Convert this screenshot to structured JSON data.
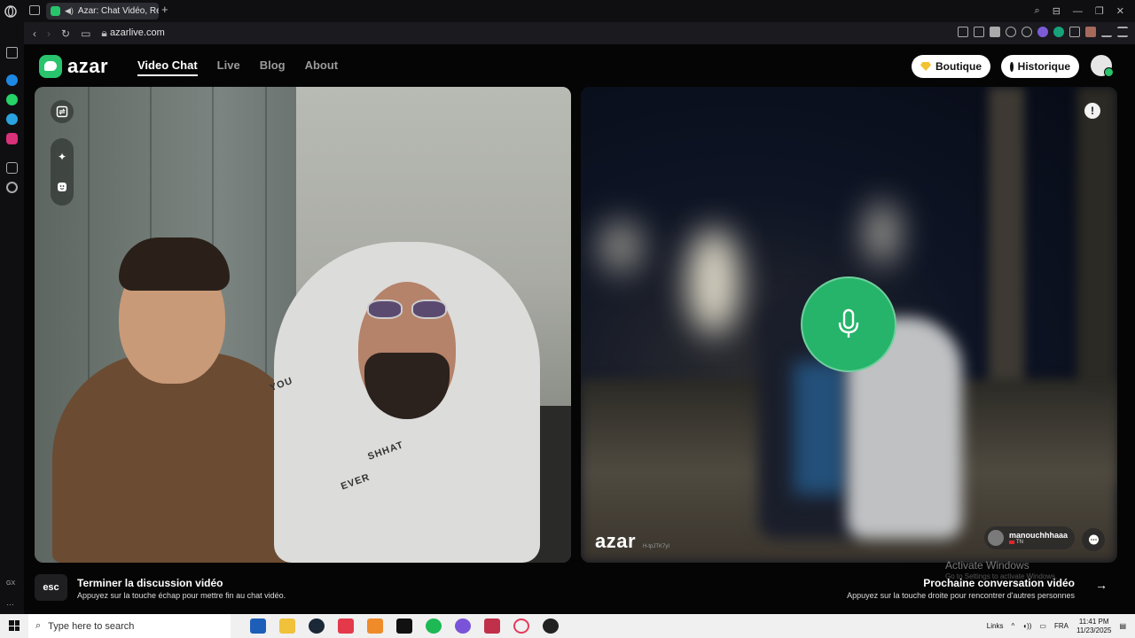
{
  "browser": {
    "tab_title": "Azar: Chat Vidéo, Ren",
    "url": "azarlive.com"
  },
  "header": {
    "logo_text": "azar",
    "nav": [
      {
        "label": "Video Chat"
      },
      {
        "label": "Live"
      },
      {
        "label": "Blog"
      },
      {
        "label": "About"
      }
    ],
    "boutique_label": "Boutique",
    "historique_label": "Historique"
  },
  "left_video": {
    "print_1": "YOU",
    "print_2": "SHHAT",
    "print_3": "EVER"
  },
  "right_video": {
    "watermark": "azar",
    "watermark_id": "H-tpJTK7yI",
    "partner_name": "manouchhhaaa",
    "partner_country": "TN",
    "report_glyph": "!"
  },
  "hints": {
    "esc_key": "esc",
    "end_title": "Terminer la discussion vidéo",
    "end_sub": "Appuyez sur la touche échap pour mettre fin au chat vidéo.",
    "next_title": "Prochaine conversation vidéo",
    "next_sub": "Appuyez sur la touche droite pour rencontrer d'autres personnes"
  },
  "windows_watermark": {
    "title": "Activate Windows",
    "sub": "Go to Settings to activate Windows."
  },
  "taskbar": {
    "search_placeholder": "Type here to search",
    "links_label": "Links",
    "lang": "FRA",
    "time": "11:41 PM",
    "date": "11/23/2025"
  },
  "colors": {
    "brand_green": "#29c46d",
    "mic_green": "#26b46a"
  }
}
